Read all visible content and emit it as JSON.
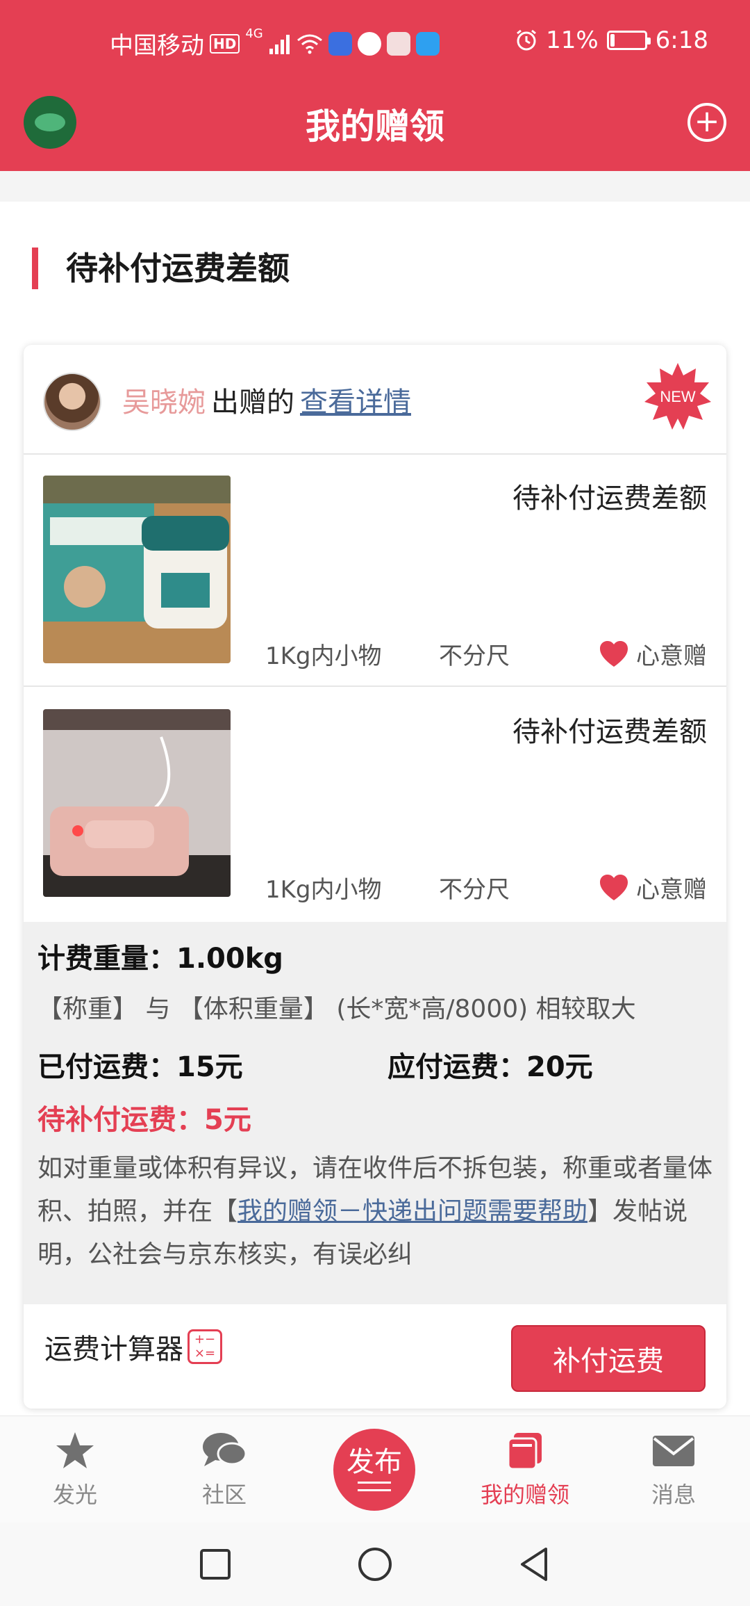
{
  "status_bar": {
    "carrier": "中国移动",
    "hd": "HD",
    "network": "4G",
    "battery": "11%",
    "battery_level": 0.11,
    "time": "6:18"
  },
  "header": {
    "title": "我的赠领"
  },
  "section": {
    "title": "待补付运费差额"
  },
  "card": {
    "giver_name": "吴晓婉",
    "giver_suffix": "出赠的",
    "detail_link": "查看详情",
    "badge": "NEW",
    "items": [
      {
        "status": "待补付运费差额",
        "weight": "1Kg内小物",
        "size": "不分尺",
        "type": "心意赠"
      },
      {
        "status": "待补付运费差额",
        "weight": "1Kg内小物",
        "size": "不分尺",
        "type": "心意赠"
      }
    ],
    "fee": {
      "billing_weight": "计费重量：1.00kg",
      "rule": "【称重】 与 【体积重量】 (长*宽*高/8000) 相较取大",
      "paid": "已付运费：15元",
      "due": "应付运费：20元",
      "remaining": "待补付运费：5元",
      "note_before": "如对重量或体积有异议，请在收件后不拆包装，称重或者量体积、拍照，并在【",
      "note_link": "我的赠领－快递出问题需要帮助",
      "note_after": "】发帖说明，公社会与京东核实，有误必纠"
    },
    "calculator_label": "运费计算器",
    "pay_button": "补付运费"
  },
  "tabbar": {
    "tabs": [
      {
        "label": "发光"
      },
      {
        "label": "社区"
      },
      {
        "label": "发布"
      },
      {
        "label": "我的赠领"
      },
      {
        "label": "消息"
      }
    ]
  },
  "colors": {
    "accent": "#e43f53",
    "link": "#4a6a9a"
  }
}
